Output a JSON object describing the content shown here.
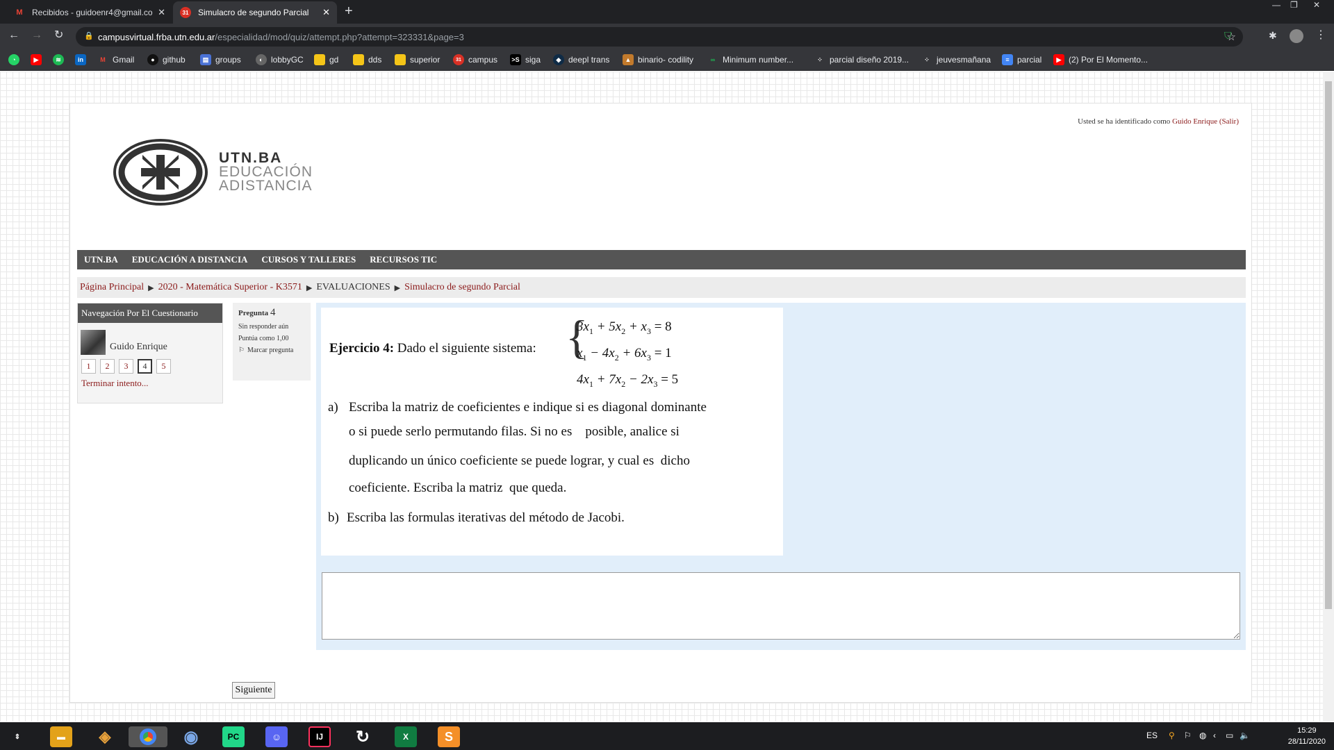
{
  "browser": {
    "tabs": [
      {
        "title": "Recibidos - guidoenr4@gmail.co",
        "icon": "gmail-icon"
      },
      {
        "title": "Simulacro de segundo Parcial",
        "icon": "moodle-icon"
      }
    ],
    "url_host": "campusvirtual.frba.utn.edu.ar",
    "url_path": "/especialidad/mod/quiz/attempt.php?attempt=323331&page=3",
    "bookmarks": [
      "Gmail",
      "github",
      "groups",
      "lobbyGC",
      "gd",
      "dds",
      "superior",
      "campus",
      "siga",
      "deepl trans",
      "binario- codility",
      "Minimum number...",
      "parcial diseño 2019...",
      "jeuvesmañana",
      "parcial",
      "(2) Por El Momento..."
    ]
  },
  "site": {
    "login_prefix": "Usted se ha identificado como",
    "login_user": "Guido Enrique",
    "logout": "(Salir)",
    "logo": {
      "line1": "UTN.BA",
      "line2": "EDUCACIÓN",
      "line3": "ADISTANCIA"
    },
    "nav": [
      "UTN.BA",
      "EDUCACIÓN A DISTANCIA",
      "CURSOS Y TALLERES",
      "RECURSOS TIC"
    ],
    "breadcrumb": [
      "Página Principal",
      "2020 - Matemática Superior - K3571",
      "EVALUACIONES",
      "Simulacro de segundo Parcial"
    ]
  },
  "quiz_nav": {
    "title": "Navegación Por El Cuestionario",
    "user": "Guido Enrique",
    "questions": [
      "1",
      "2",
      "3",
      "4",
      "5"
    ],
    "current": "4",
    "finish": "Terminar intento..."
  },
  "question_info": {
    "label": "Pregunta",
    "number": "4",
    "status": "Sin responder aún",
    "score": "Puntúa como 1,00",
    "flag": "Marcar pregunta"
  },
  "exercise": {
    "title": "Ejercicio 4:",
    "intro": "Dado el siguiente sistema:",
    "eq1": {
      "a": "3x",
      "b": " + 5x",
      "c": " + x",
      "rhs": " = 8"
    },
    "eq2": {
      "a": "x",
      "b": " − 4x",
      "c": " + 6x",
      "rhs": " = 1"
    },
    "eq3": {
      "a": "4x",
      "b": " + 7x",
      "c": " − 2x",
      "rhs": " = 5"
    },
    "sub1": "1",
    "sub2": "2",
    "sub3": "3",
    "part_a_label": "a)",
    "part_a_lines": [
      "Escriba la matriz de coeficientes e indique si es diagonal dominante",
      "o si puede serlo permutando filas. Si no es    posible, analice si",
      "duplicando un único coeficiente se puede lograr, y cual es  dicho",
      "coeficiente. Escriba la matriz  que queda."
    ],
    "part_b_label": "b)",
    "part_b": "Escriba las formulas iterativas del método de Jacobi."
  },
  "answer_value": "",
  "next_button": "Siguiente",
  "taskbar": {
    "lang": "ES",
    "time": "15:29",
    "date": "28/11/2020"
  }
}
